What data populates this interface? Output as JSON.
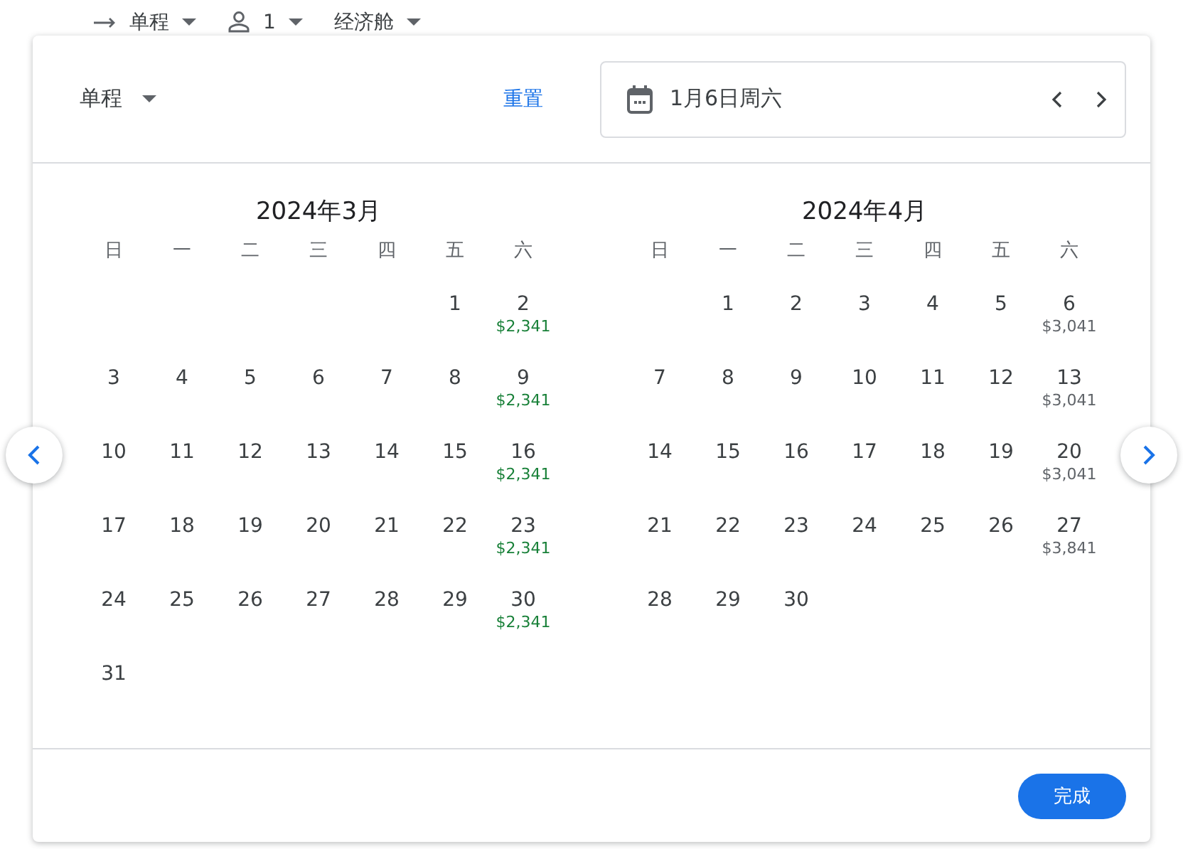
{
  "top_bar": {
    "trip_type": "单程",
    "passengers": "1",
    "cabin": "经济舱"
  },
  "header": {
    "trip_type": "单程",
    "reset": "重置",
    "date": "1月6日周六"
  },
  "months": [
    {
      "title": "2024年3月",
      "weekdays": [
        "日",
        "一",
        "二",
        "三",
        "四",
        "五",
        "六"
      ],
      "weeks": [
        {
          "kind": "leading",
          "days": [
            {
              "day": "1"
            },
            {
              "day": "2",
              "price": "$2,341",
              "low": true
            }
          ]
        },
        {
          "kind": "full",
          "days": [
            {
              "day": "3"
            },
            {
              "day": "4"
            },
            {
              "day": "5"
            },
            {
              "day": "6"
            },
            {
              "day": "7"
            },
            {
              "day": "8"
            },
            {
              "day": "9",
              "price": "$2,341",
              "low": true
            }
          ]
        },
        {
          "kind": "full",
          "days": [
            {
              "day": "10"
            },
            {
              "day": "11"
            },
            {
              "day": "12"
            },
            {
              "day": "13"
            },
            {
              "day": "14"
            },
            {
              "day": "15"
            },
            {
              "day": "16",
              "price": "$2,341",
              "low": true
            }
          ]
        },
        {
          "kind": "full",
          "days": [
            {
              "day": "17"
            },
            {
              "day": "18"
            },
            {
              "day": "19"
            },
            {
              "day": "20"
            },
            {
              "day": "21"
            },
            {
              "day": "22"
            },
            {
              "day": "23",
              "price": "$2,341",
              "low": true
            }
          ]
        },
        {
          "kind": "full",
          "days": [
            {
              "day": "24"
            },
            {
              "day": "25"
            },
            {
              "day": "26"
            },
            {
              "day": "27"
            },
            {
              "day": "28"
            },
            {
              "day": "29"
            },
            {
              "day": "30",
              "price": "$2,341",
              "low": true
            }
          ]
        },
        {
          "kind": "trailing",
          "days": [
            {
              "day": "31"
            }
          ]
        }
      ]
    },
    {
      "title": "2024年4月",
      "weekdays": [
        "日",
        "一",
        "二",
        "三",
        "四",
        "五",
        "六"
      ],
      "weeks": [
        {
          "kind": "leading",
          "days": [
            {
              "day": "1"
            },
            {
              "day": "2"
            },
            {
              "day": "3"
            },
            {
              "day": "4"
            },
            {
              "day": "5"
            },
            {
              "day": "6",
              "price": "$3,041",
              "low": false
            }
          ]
        },
        {
          "kind": "full",
          "days": [
            {
              "day": "7"
            },
            {
              "day": "8"
            },
            {
              "day": "9"
            },
            {
              "day": "10"
            },
            {
              "day": "11"
            },
            {
              "day": "12"
            },
            {
              "day": "13",
              "price": "$3,041",
              "low": false
            }
          ]
        },
        {
          "kind": "full",
          "days": [
            {
              "day": "14"
            },
            {
              "day": "15"
            },
            {
              "day": "16"
            },
            {
              "day": "17"
            },
            {
              "day": "18"
            },
            {
              "day": "19"
            },
            {
              "day": "20",
              "price": "$3,041",
              "low": false
            }
          ]
        },
        {
          "kind": "full",
          "days": [
            {
              "day": "21"
            },
            {
              "day": "22"
            },
            {
              "day": "23"
            },
            {
              "day": "24"
            },
            {
              "day": "25"
            },
            {
              "day": "26"
            },
            {
              "day": "27",
              "price": "$3,841",
              "low": false
            }
          ]
        },
        {
          "kind": "trailing",
          "days": [
            {
              "day": "28"
            },
            {
              "day": "29"
            },
            {
              "day": "30"
            }
          ]
        }
      ]
    }
  ],
  "done_button": "完成"
}
